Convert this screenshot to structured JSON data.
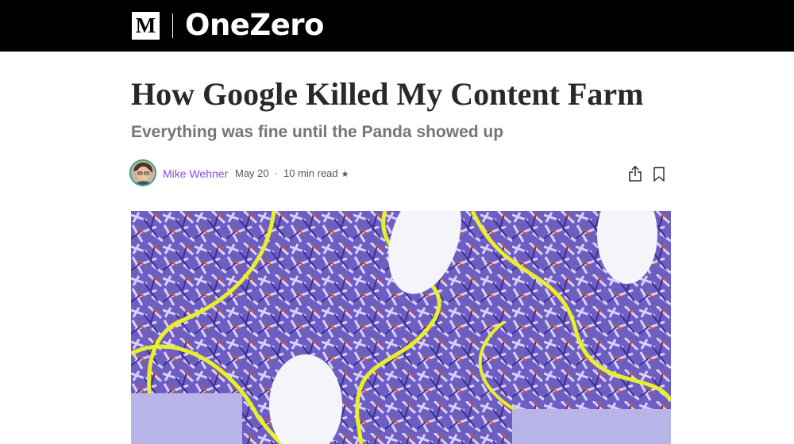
{
  "header": {
    "logo_letter": "M",
    "publication": "OneZero",
    "background": "#000000"
  },
  "article": {
    "title": "How Google Killed My Content Farm",
    "subtitle": "Everything was fine until the Panda showed up"
  },
  "byline": {
    "author": "Mike Wehner",
    "date": "May 20",
    "separator": "·",
    "read_time": "10 min read",
    "member_icon": "star-icon",
    "author_color": "#8a4cdb",
    "avatar_ring": "#3ea37a"
  },
  "actions": {
    "share_icon": "share-icon",
    "bookmark_icon": "bookmark-icon"
  },
  "hero_image": {
    "icon": "shredded-paper-keyboard-mouse-image",
    "palette": [
      "#6f5ec2",
      "#d8d2ff",
      "#e8f02a",
      "#f4f4fb"
    ]
  }
}
